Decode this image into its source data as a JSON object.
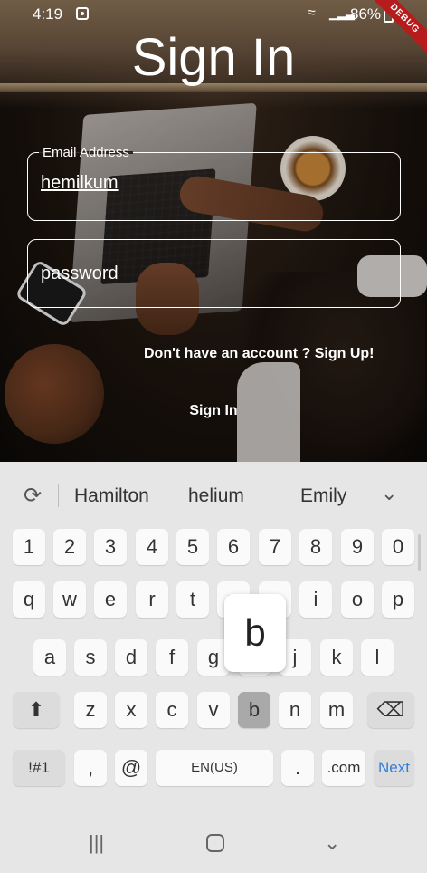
{
  "status_bar": {
    "time": "4:19",
    "battery": "86%",
    "debug_banner": "DEBUG"
  },
  "screen": {
    "title": "Sign In",
    "email_field": {
      "label": "Email Address",
      "value": "hemilkum"
    },
    "password_field": {
      "placeholder": "password"
    },
    "signup_link": "Don't have an account ? Sign Up!",
    "signin_button": "Sign In"
  },
  "keyboard": {
    "suggestions": [
      "Hamilton",
      "helium",
      "Emily"
    ],
    "number_row": [
      "1",
      "2",
      "3",
      "4",
      "5",
      "6",
      "7",
      "8",
      "9",
      "0"
    ],
    "row1": [
      "q",
      "w",
      "e",
      "r",
      "t",
      "y",
      "u",
      "i",
      "o",
      "p"
    ],
    "row2": [
      "a",
      "s",
      "d",
      "f",
      "g",
      "h",
      "j",
      "k",
      "l"
    ],
    "row3": [
      "z",
      "x",
      "c",
      "v",
      "b",
      "n",
      "m"
    ],
    "symbols_key": "!#1",
    "comma_key": ",",
    "at_key": "@",
    "space_key": "EN(US)",
    "period_key": ".",
    "dotcom_key": ".com",
    "next_key": "Next",
    "pressed_key": "b",
    "popup_letter": "b"
  },
  "colors": {
    "keyboard_bg": "#e6e6e6",
    "next_accent": "#2f7fdb",
    "debug_ribbon": "#b71c1c"
  },
  "icons": {
    "status": [
      "notification-icon",
      "wifi-icon",
      "signal-icon",
      "battery-icon"
    ],
    "keyboard": [
      "refresh-icon",
      "chevron-down-icon",
      "shift-icon",
      "backspace-icon"
    ],
    "navigation": [
      "recent-apps-icon",
      "home-icon",
      "back-icon"
    ]
  }
}
